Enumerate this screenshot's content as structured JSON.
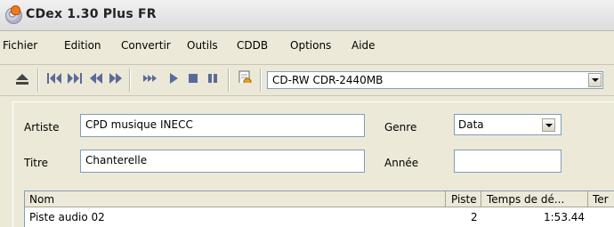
{
  "window": {
    "title": "CDex 1.30 Plus FR"
  },
  "menu": [
    "Fichier",
    "Edition",
    "Convertir",
    "Outils",
    "CDDB",
    "Options",
    "Aide"
  ],
  "toolbar": {
    "buttons": [
      "eject-icon",
      "skip-back-icon",
      "skip-forward-icon",
      "rewind-icon",
      "fast-forward-icon",
      "fast-play-icon",
      "play-icon",
      "stop-icon",
      "pause-icon",
      "refresh-icon"
    ],
    "drive": "CD-RW  CDR-2440MB"
  },
  "form": {
    "artist_label": "Artiste",
    "artist_value": "CPD musique INECC",
    "title_label": "Titre",
    "title_value": "Chanterelle",
    "genre_label": "Genre",
    "genre_value": "Data",
    "year_label": "Année",
    "year_value": ""
  },
  "tracks": {
    "columns": [
      "Nom",
      "Piste",
      "Temps de dé...",
      "Ter"
    ],
    "rows": [
      {
        "name": "Piste audio 02",
        "track": "2",
        "start": "1:53.44"
      }
    ]
  }
}
